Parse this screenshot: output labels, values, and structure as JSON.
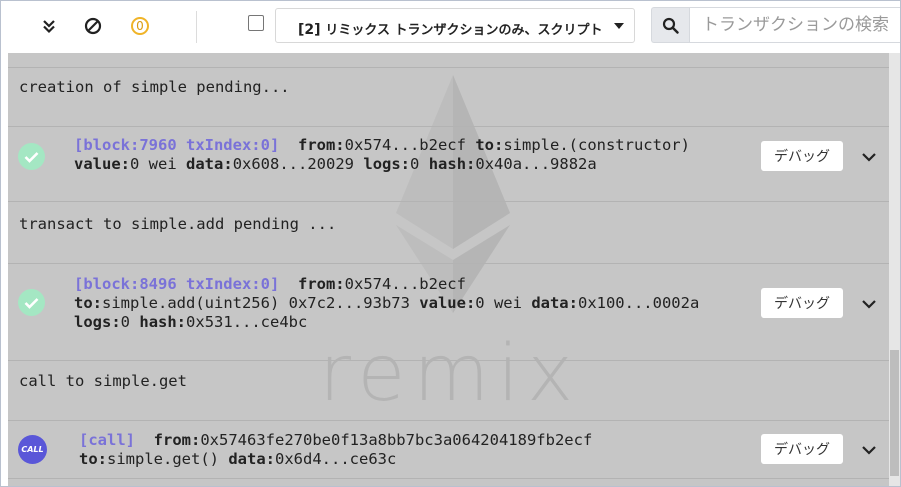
{
  "toolbar": {
    "collapse_icon": "double-chevron-down-icon",
    "clear_icon": "ban-icon",
    "pending_count": "0",
    "select_prefix": "[2]",
    "select_value": "リミックス トランザクションのみ、スクリプト",
    "search_placeholder": "トランザクションの検索"
  },
  "terminal": {
    "watermark": "remix",
    "log_lines": [
      "creation of simple pending...",
      "transact to simple.add pending ...",
      "call to simple.get"
    ],
    "tx1": {
      "tag": "[block:7960 txIndex:0]",
      "from_label": "from:",
      "from_value": "0x574...b2ecf",
      "to_label": "to:",
      "to_value": "simple.(constructor)",
      "value_label": "value:",
      "value_value": "0 wei",
      "data_label": "data:",
      "data_value": "0x608...20029",
      "logs_label": "logs:",
      "logs_value": "0",
      "hash_label": "hash:",
      "hash_value": "0x40a...9882a",
      "debug_label": "デバッグ"
    },
    "tx2": {
      "tag": "[block:8496 txIndex:0]",
      "from_label": "from:",
      "from_value": "0x574...b2ecf",
      "to_label": "to:",
      "to_value": "simple.add(uint256) 0x7c2...93b73",
      "value_label": "value:",
      "value_value": "0 wei",
      "data_label": "data:",
      "data_value": "0x100...0002a",
      "logs_label": "logs:",
      "logs_value": "0",
      "hash_label": "hash:",
      "hash_value": "0x531...ce4bc",
      "debug_label": "デバッグ"
    },
    "tx3": {
      "badge": "CALL",
      "tag": "[call]",
      "from_label": "from:",
      "from_value": "0x57463fe270be0f13a8bb7bc3a064204189fb2ecf",
      "to_label": "to:",
      "to_value": "simple.get()",
      "data_label": "data:",
      "data_value": "0x6d4...ce63c",
      "debug_label": "デバッグ"
    }
  },
  "colors": {
    "terminal_bg": "#c6c6c6",
    "block_tag": "#7a72d8",
    "success_check": "#a4e7c3",
    "call_badge": "#5a57d8",
    "pending_badge": "#f0b428"
  }
}
